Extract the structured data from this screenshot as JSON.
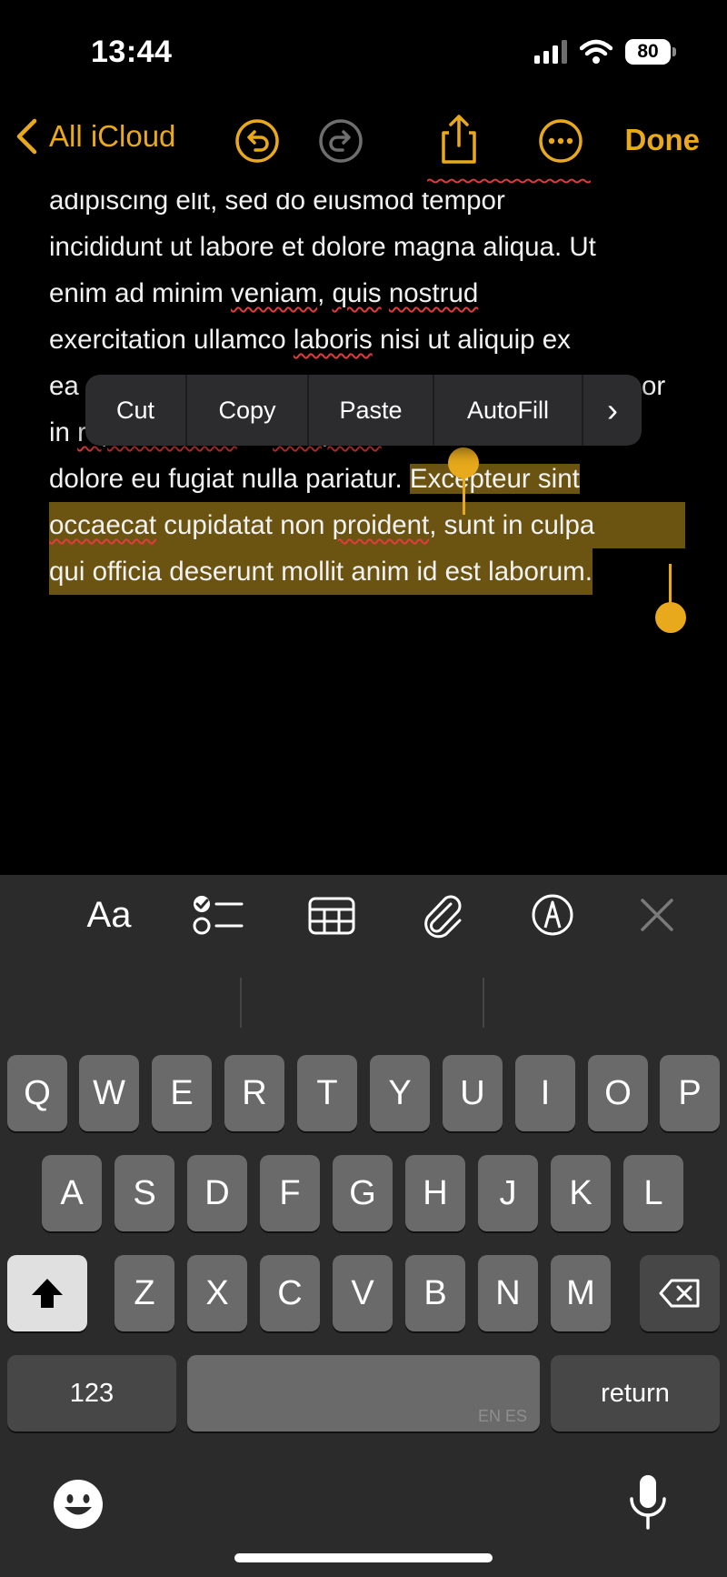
{
  "status": {
    "time": "13:44",
    "battery": "80"
  },
  "nav": {
    "back_label": "All iCloud",
    "done_label": "Done"
  },
  "note": {
    "lines": [
      "adipiscing elit, sed do eiusmod tempor",
      "incididunt ut labore et dolore magna aliqua. Ut",
      "enim ad minim veniam, quis nostrud",
      "exercitation ullamco laboris nisi ut aliquip ex",
      "ea",
      "in reprehenderit in voluptate velit esse cillum",
      "dolore eu fugiat nulla pariatur. ",
      "Excepteur sint",
      "occaecat cupidatat non proident, sunt in culpa",
      "qui officia deserunt mollit anim id est laborum."
    ],
    "hidden_right": "or"
  },
  "menu": {
    "items": [
      "Cut",
      "Copy",
      "Paste",
      "AutoFill"
    ],
    "more": "›"
  },
  "toolbar": {
    "format_label": "Aa"
  },
  "keyboard": {
    "row1": [
      "Q",
      "W",
      "E",
      "R",
      "T",
      "Y",
      "U",
      "I",
      "O",
      "P"
    ],
    "row2": [
      "A",
      "S",
      "D",
      "F",
      "G",
      "H",
      "J",
      "K",
      "L"
    ],
    "row3": [
      "Z",
      "X",
      "C",
      "V",
      "B",
      "N",
      "M"
    ],
    "numbers_label": "123",
    "space_lang": "EN ES",
    "return_label": "return"
  },
  "colors": {
    "accent": "#E8AA1C",
    "selection": "#6b5412",
    "keyboard_bg": "#2b2b2b"
  }
}
